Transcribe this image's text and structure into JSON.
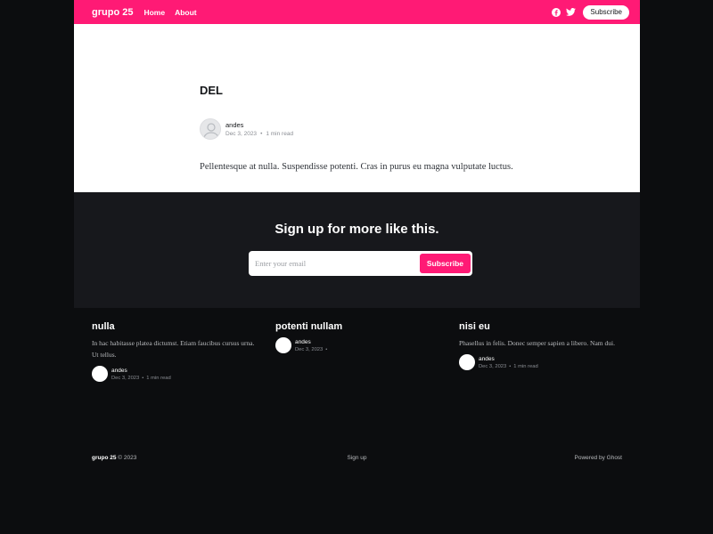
{
  "header": {
    "site_title": "grupo 25",
    "nav": [
      "Home",
      "About"
    ],
    "subscribe_label": "Subscribe",
    "icons": [
      "facebook-icon",
      "twitter-icon"
    ],
    "colors": {
      "accent": "#ff1a75"
    }
  },
  "article": {
    "title": "DEL",
    "author": "andes",
    "date": "Dec 3, 2023",
    "read_time": "1 min read",
    "body": "Pellentesque at nulla. Suspendisse potenti. Cras in purus eu magna vulputate luctus."
  },
  "signup": {
    "title": "Sign up for more like this.",
    "email_placeholder": "Enter your email",
    "button_label": "Subscribe"
  },
  "posts": [
    {
      "title": "nulla",
      "excerpt": "In hac habitasse platea dictumst. Etiam faucibus cursus urna. Ut tellus.",
      "author": "andes",
      "date": "Dec 3, 2023",
      "read_time": "1 min read"
    },
    {
      "title": "potenti nullam",
      "excerpt": "",
      "author": "andes",
      "date": "Dec 3, 2023",
      "read_time": ""
    },
    {
      "title": "nisi eu",
      "excerpt": "Phasellus in felis. Donec semper sapien a libero. Nam dui.",
      "author": "andes",
      "date": "Dec 3, 2023",
      "read_time": "1 min read"
    }
  ],
  "footer": {
    "site_name": "grupo 25",
    "copyright": "© 2023",
    "signup_link": "Sign up",
    "powered_by": "Powered by Ghost"
  }
}
